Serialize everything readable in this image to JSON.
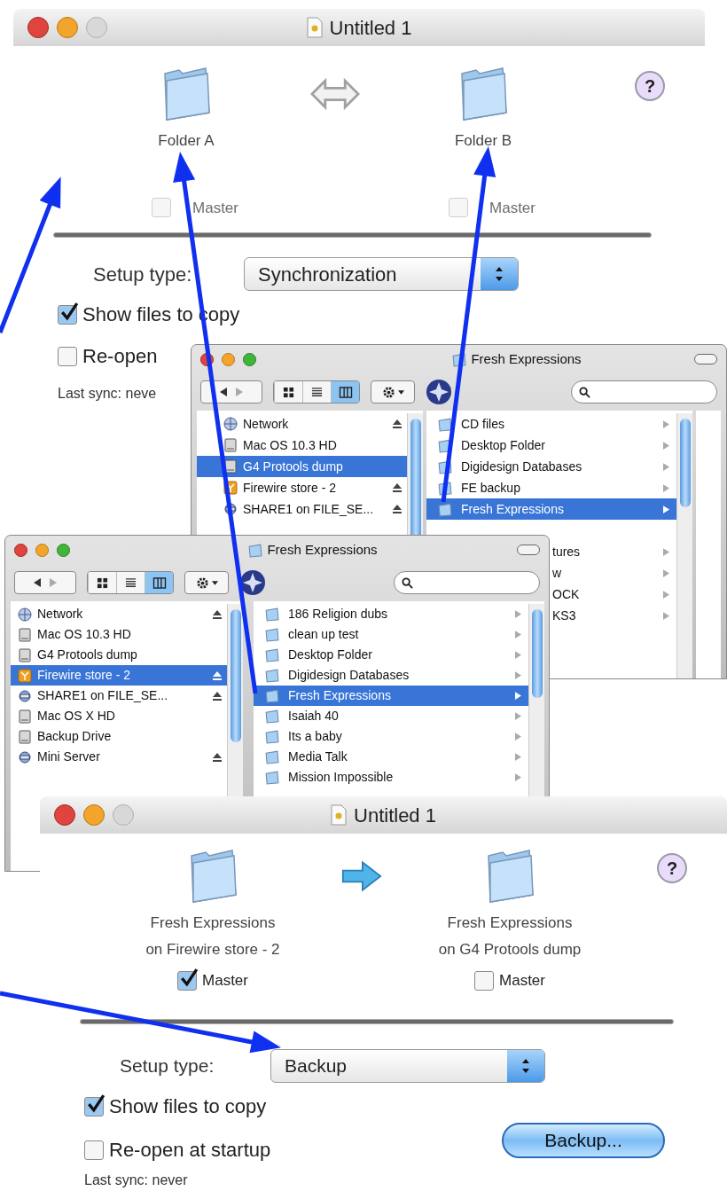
{
  "top_window": {
    "kind": "sync",
    "title": "Untitled 1",
    "help": "?",
    "folders": [
      {
        "label": "Folder A",
        "master": {
          "label": "Master",
          "checked": false,
          "disabled": true
        }
      },
      {
        "label": "Folder B",
        "master": {
          "label": "Master",
          "checked": false,
          "disabled": true
        }
      }
    ],
    "setup_type": {
      "label": "Setup type:",
      "value": "Synchronization"
    },
    "options": [
      {
        "label": "Show files to copy",
        "checked": true
      },
      {
        "label": "Re-open",
        "checked": false
      }
    ],
    "last_sync": "Last sync: neve"
  },
  "back_finder": {
    "title": "Fresh Expressions",
    "view_modes": [
      {
        "kind": "icon",
        "selected": false
      },
      {
        "kind": "list",
        "selected": false
      },
      {
        "kind": "column",
        "selected": true
      }
    ],
    "sidebar": [
      {
        "name": "Network",
        "kind": "network",
        "eject": true,
        "selected": false
      },
      {
        "name": "Mac OS 10.3 HD",
        "kind": "disk",
        "eject": false,
        "selected": false
      },
      {
        "name": "G4 Protools dump",
        "kind": "disk",
        "eject": false,
        "selected": true
      },
      {
        "name": "Firewire store - 2",
        "kind": "firewire",
        "eject": true,
        "selected": false
      },
      {
        "name": "SHARE1 on FILE_SE...",
        "kind": "server",
        "eject": true,
        "selected": false
      }
    ],
    "column": [
      {
        "name": "CD files",
        "selected": false
      },
      {
        "name": "Desktop Folder",
        "selected": false
      },
      {
        "name": "Digidesign Databases",
        "selected": false
      },
      {
        "name": "FE backup",
        "selected": false
      },
      {
        "name": "Fresh Expressions",
        "selected": true
      }
    ],
    "column_clipped": [
      "tures",
      "w",
      "OCK",
      "KS3"
    ]
  },
  "front_finder": {
    "title": "Fresh Expressions",
    "view_modes": [
      {
        "kind": "icon",
        "selected": false
      },
      {
        "kind": "list",
        "selected": false
      },
      {
        "kind": "column",
        "selected": true
      }
    ],
    "sidebar": [
      {
        "name": "Network",
        "kind": "network",
        "eject": true,
        "selected": false
      },
      {
        "name": "Mac OS 10.3 HD",
        "kind": "disk",
        "eject": false,
        "selected": false
      },
      {
        "name": "G4 Protools dump",
        "kind": "disk",
        "eject": false,
        "selected": false
      },
      {
        "name": "Firewire store - 2",
        "kind": "firewire",
        "eject": true,
        "selected": true
      },
      {
        "name": "SHARE1 on FILE_SE...",
        "kind": "server",
        "eject": true,
        "selected": false
      },
      {
        "name": "Mac OS X HD",
        "kind": "disk",
        "eject": false,
        "selected": false
      },
      {
        "name": "Backup Drive",
        "kind": "disk",
        "eject": false,
        "selected": false
      },
      {
        "name": "Mini Server",
        "kind": "server",
        "eject": true,
        "selected": false
      }
    ],
    "column": [
      {
        "name": "186 Religion dubs",
        "selected": false
      },
      {
        "name": "clean up test",
        "selected": false
      },
      {
        "name": "Desktop Folder",
        "selected": false
      },
      {
        "name": "Digidesign Databases",
        "selected": false
      },
      {
        "name": "Fresh Expressions",
        "selected": true
      },
      {
        "name": "Isaiah 40",
        "selected": false
      },
      {
        "name": "Its a baby",
        "selected": false
      },
      {
        "name": "Media Talk",
        "selected": false
      },
      {
        "name": "Mission Impossible",
        "selected": false
      }
    ]
  },
  "bottom_window": {
    "kind": "backup",
    "title": "Untitled 1",
    "help": "?",
    "folders": [
      {
        "label": "Fresh Expressions",
        "sublabel": "on Firewire store - 2",
        "master": {
          "label": "Master",
          "checked": true,
          "disabled": false
        }
      },
      {
        "label": "Fresh Expressions",
        "sublabel": "on G4 Protools dump",
        "master": {
          "label": "Master",
          "checked": false,
          "disabled": false
        }
      }
    ],
    "setup_type": {
      "label": "Setup type:",
      "value": "Backup"
    },
    "options": [
      {
        "label": "Show files to copy",
        "checked": true
      },
      {
        "label": "Re-open at startup",
        "checked": false
      }
    ],
    "action_button": "Backup...",
    "last_sync": "Last sync: never"
  }
}
